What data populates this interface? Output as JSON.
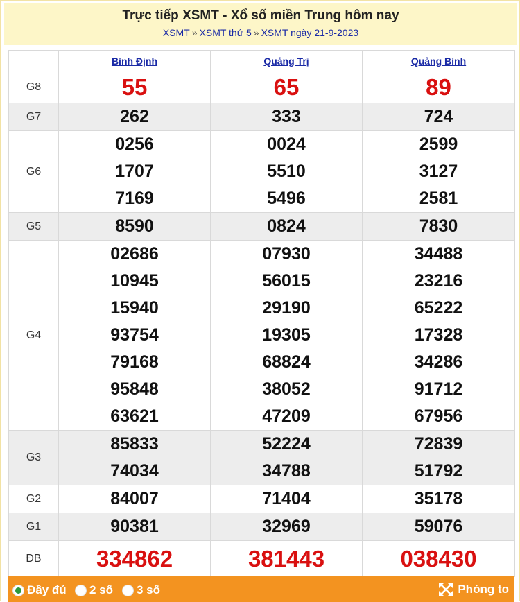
{
  "header": {
    "title": "Trực tiếp XSMT - Xổ số miền Trung hôm nay",
    "breadcrumbs": [
      "XSMT",
      "XSMT thứ 5",
      "XSMT ngày 21-9-2023"
    ],
    "separator": "»"
  },
  "provinces": [
    "Bình Định",
    "Quảng Trị",
    "Quảng Bình"
  ],
  "prizes": {
    "g8": {
      "label": "G8",
      "values": [
        [
          "55"
        ],
        [
          "65"
        ],
        [
          "89"
        ]
      ]
    },
    "g7": {
      "label": "G7",
      "values": [
        [
          "262"
        ],
        [
          "333"
        ],
        [
          "724"
        ]
      ]
    },
    "g6": {
      "label": "G6",
      "values": [
        [
          "0256",
          "1707",
          "7169"
        ],
        [
          "0024",
          "5510",
          "5496"
        ],
        [
          "2599",
          "3127",
          "2581"
        ]
      ]
    },
    "g5": {
      "label": "G5",
      "values": [
        [
          "8590"
        ],
        [
          "0824"
        ],
        [
          "7830"
        ]
      ]
    },
    "g4": {
      "label": "G4",
      "values": [
        [
          "02686",
          "10945",
          "15940",
          "93754",
          "79168",
          "95848",
          "63621"
        ],
        [
          "07930",
          "56015",
          "29190",
          "19305",
          "68824",
          "38052",
          "47209"
        ],
        [
          "34488",
          "23216",
          "65222",
          "17328",
          "34286",
          "91712",
          "67956"
        ]
      ]
    },
    "g3": {
      "label": "G3",
      "values": [
        [
          "85833",
          "74034"
        ],
        [
          "52224",
          "34788"
        ],
        [
          "72839",
          "51792"
        ]
      ]
    },
    "g2": {
      "label": "G2",
      "values": [
        [
          "84007"
        ],
        [
          "71404"
        ],
        [
          "35178"
        ]
      ]
    },
    "g1": {
      "label": "G1",
      "values": [
        [
          "90381"
        ],
        [
          "32969"
        ],
        [
          "59076"
        ]
      ]
    },
    "db": {
      "label": "ĐB",
      "values": [
        [
          "334862"
        ],
        [
          "381443"
        ],
        [
          "038430"
        ]
      ]
    }
  },
  "footer": {
    "options": [
      "Đầy đủ",
      "2 số",
      "3 số"
    ],
    "selected": "Đầy đủ",
    "zoom_label": "Phóng to",
    "zoom_icon": "expand-arrows-icon"
  },
  "colors": {
    "header_bg": "#fdf6c8",
    "link": "#1a2aa6",
    "highlight_red": "#d91010",
    "footer_bg": "#f39320",
    "selected_radio": "#2c9a3c"
  }
}
